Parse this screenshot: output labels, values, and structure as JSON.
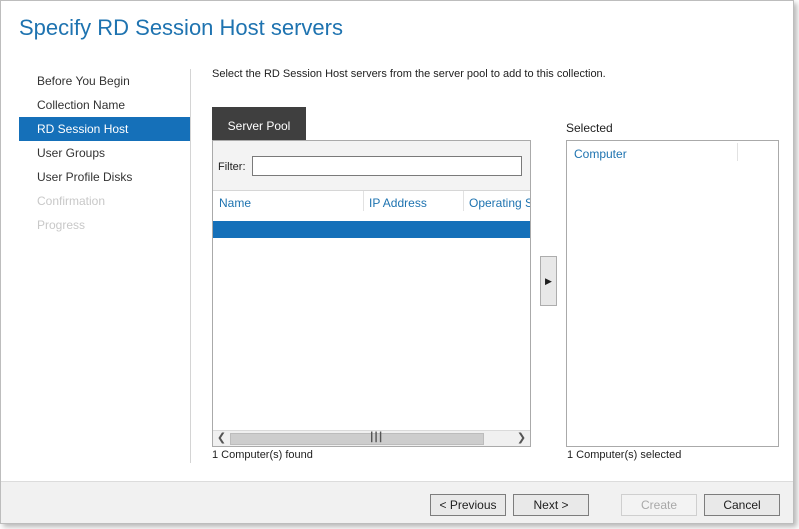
{
  "window": {
    "title": "Specify RD Session Host servers"
  },
  "nav": {
    "items": [
      {
        "label": "Before You Begin",
        "state": "normal"
      },
      {
        "label": "Collection Name",
        "state": "normal"
      },
      {
        "label": "RD Session Host",
        "state": "active"
      },
      {
        "label": "User Groups",
        "state": "normal"
      },
      {
        "label": "User Profile Disks",
        "state": "normal"
      },
      {
        "label": "Confirmation",
        "state": "disabled"
      },
      {
        "label": "Progress",
        "state": "disabled"
      }
    ]
  },
  "content": {
    "instruction": "Select the RD Session Host servers from the server pool to add to this collection.",
    "server_pool": {
      "tab_label": "Server Pool",
      "filter_label": "Filter:",
      "filter_value": "",
      "columns": [
        "Name",
        "IP Address",
        "Operating S"
      ],
      "status": "1 Computer(s) found"
    },
    "add_button_icon": "▶",
    "selected": {
      "label": "Selected",
      "columns": [
        "Computer"
      ],
      "status": "1 Computer(s) selected"
    }
  },
  "footer": {
    "previous_label": "< Previous",
    "next_label": "Next >",
    "create_label": "Create",
    "cancel_label": "Cancel"
  },
  "colors": {
    "accent": "#1570b9",
    "title": "#1e73b0",
    "tab": "#3f3f3f"
  }
}
